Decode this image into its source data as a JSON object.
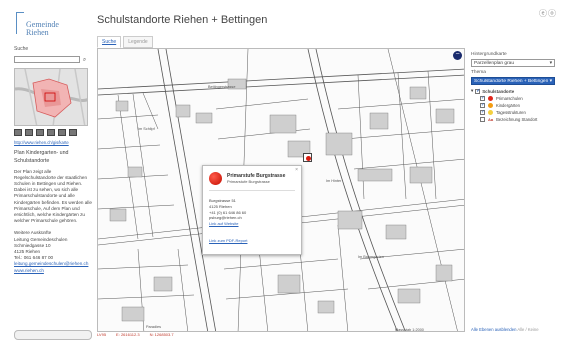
{
  "header": {
    "logo_line1": "Gemeinde",
    "logo_line2": "Riehen",
    "title": "Schulstandorte Riehen + Bettingen",
    "top_right": "ⓔⓞ"
  },
  "tabs": [
    {
      "label": "Suche",
      "active": true
    },
    {
      "label": "Legende",
      "active": false
    }
  ],
  "sidebar": {
    "search_label": "Suche",
    "search_value": "",
    "search_icon": "magnifier-icon",
    "link": "http://www.riehen.ch/gis/karte",
    "plan_title": "Plan Kindergarten- und Schulstandorte",
    "description": "Der Plan zeigt alle Regelschulstandorte der staatlichen Schulen in Bettingen und Riehen. Dabei ist zu sehen, wo sich alle Primarschulstandorte und alle Kindergärten befinden. Es werden alle Primarschule, Auf dem Plan und ersichtlich, welche Kindergärten zu welcher Primarschule gehören.",
    "contact_label": "Weitere Auskünfte",
    "contact_lines": [
      "Leitung Gemeindeschulen",
      "Schmiedgasse 10",
      "4125 Riehen",
      "Tel.: 061 646 87 00"
    ],
    "contact_email": "leitung.gemeindeschulen@riehen.ch",
    "contact_web": "www.riehen.ch"
  },
  "map": {
    "labels": [
      "Im Schlipf",
      "Bettingerstrasse",
      "Im Hinter",
      "Im Baumgarten",
      "Paradies"
    ],
    "zoom_in_icon": "minus-icon"
  },
  "popup": {
    "name": "Primarstufe Burgstrasse",
    "subtitle": "Primarstufe Burgstrasse",
    "address_lines": [
      "Burgstrasse 51",
      "4125 Riehen",
      "+41 (0) 61 646 86 60",
      "psburg@riehen.ch"
    ],
    "website_link": "Link auf Website",
    "pdf_link": "Link zum PDF-Report",
    "close": "×"
  },
  "status": {
    "items": [
      "LV95",
      "E: 2616112.3",
      "N: 1268503.7"
    ],
    "scale": "Massstab 1:2000"
  },
  "right": {
    "base_label": "Hintergrundkarte",
    "base_value": "Parzellenplan grau",
    "theme_label": "Thema",
    "theme_value": "Schulstandorte Riehen + Bettingen",
    "tree_root": "Schulstandorte",
    "items": [
      {
        "label": "Primarschulen",
        "color": "#e1261c",
        "checked": true
      },
      {
        "label": "Kindergärten",
        "color": "#f39c12",
        "checked": true
      },
      {
        "label": "Tagesstrukturen",
        "color": "#f4d03f",
        "checked": true
      },
      {
        "label": "Bezeichnung Standort",
        "color": "#c0392b",
        "checked": false
      }
    ],
    "bottom_link": "Alle Ebenen ausblenden",
    "bottom_extra": "Alle / Keine"
  }
}
